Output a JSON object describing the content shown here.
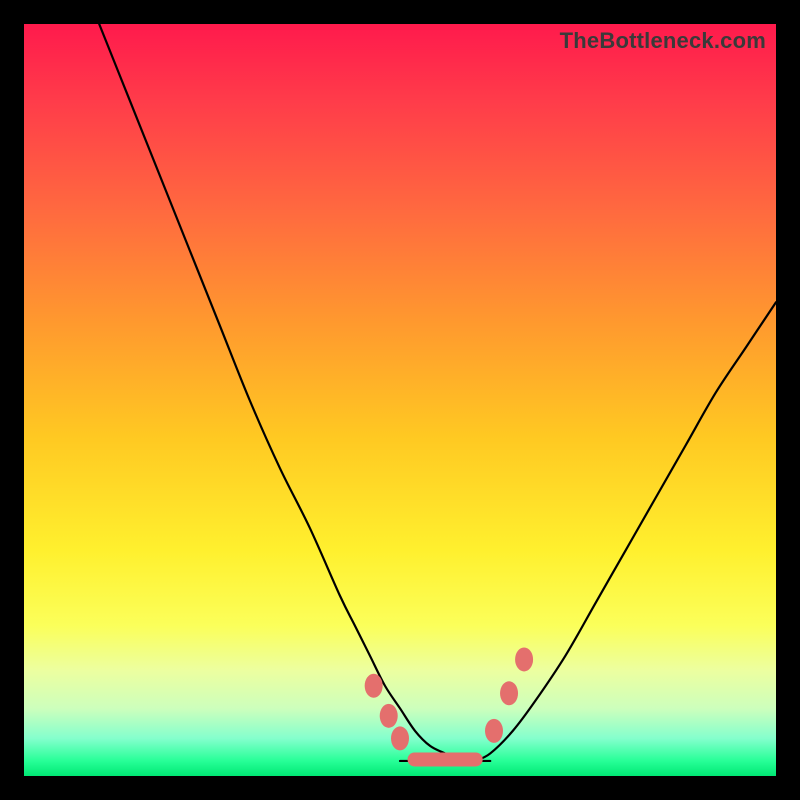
{
  "watermark": "TheBottleneck.com",
  "colors": {
    "frame": "#000000",
    "gradient_top": "#ff1a4c",
    "gradient_bottom": "#00e874",
    "curve": "#000000",
    "marker": "#e46f6d"
  },
  "chart_data": {
    "type": "line",
    "title": "",
    "xlabel": "",
    "ylabel": "",
    "xlim": [
      0,
      100
    ],
    "ylim": [
      0,
      100
    ],
    "grid": false,
    "legend": false,
    "note": "No tick labels, axis text, or legend are rendered in the image. Values are estimated from pixel positions on a 0–100 normalized scale (0,0 = bottom-left of the gradient area).",
    "series": [
      {
        "name": "left_curve",
        "x": [
          10,
          14,
          18,
          22,
          26,
          30,
          34,
          38,
          42,
          44,
          46,
          48,
          50,
          52,
          54,
          56,
          58,
          60
        ],
        "y": [
          100,
          90,
          80,
          70,
          60,
          50,
          41,
          33,
          24,
          20,
          16,
          12,
          9,
          6,
          4,
          3,
          2,
          2
        ]
      },
      {
        "name": "floor",
        "x": [
          50,
          52,
          54,
          56,
          58,
          60,
          62
        ],
        "y": [
          2,
          2,
          2,
          2,
          2,
          2,
          2
        ]
      },
      {
        "name": "right_curve",
        "x": [
          60,
          62,
          65,
          68,
          72,
          76,
          80,
          84,
          88,
          92,
          96,
          100
        ],
        "y": [
          2,
          3,
          6,
          10,
          16,
          23,
          30,
          37,
          44,
          51,
          57,
          63
        ]
      }
    ],
    "markers": [
      {
        "shape": "ellipse",
        "x": 46.5,
        "y": 12.0,
        "note": "left upper bead"
      },
      {
        "shape": "ellipse",
        "x": 48.5,
        "y": 8.0,
        "note": "left mid bead"
      },
      {
        "shape": "ellipse",
        "x": 50.0,
        "y": 5.0,
        "note": "left lower bead"
      },
      {
        "shape": "pill",
        "x_from": 51.0,
        "x_to": 61.0,
        "y": 2.2,
        "note": "bottom flat beads"
      },
      {
        "shape": "ellipse",
        "x": 62.5,
        "y": 6.0,
        "note": "right lower bead"
      },
      {
        "shape": "ellipse",
        "x": 64.5,
        "y": 11.0,
        "note": "right mid bead"
      },
      {
        "shape": "ellipse",
        "x": 66.5,
        "y": 15.5,
        "note": "right upper bead"
      }
    ]
  }
}
